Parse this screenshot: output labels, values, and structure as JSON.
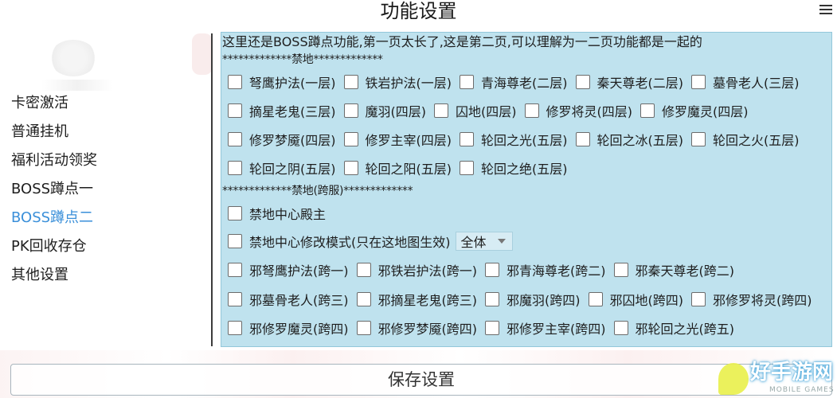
{
  "title": "功能设置",
  "sidebar": {
    "items": [
      {
        "label": "卡密激活",
        "active": false
      },
      {
        "label": "普通挂机",
        "active": false
      },
      {
        "label": "福利活动领奖",
        "active": false
      },
      {
        "label": "BOSS蹲点一",
        "active": false
      },
      {
        "label": "BOSS蹲点二",
        "active": true
      },
      {
        "label": "PK回收存仓",
        "active": false
      },
      {
        "label": "其他设置",
        "active": false
      }
    ]
  },
  "panel": {
    "intro": "这里还是BOSS蹲点功能,第一页太长了,这是第二页,可以理解为一二页功能都是一起的",
    "section1_header": "*************禁地*************",
    "section1_rows": [
      [
        "弩鹰护法(一层)",
        "铁岩护法(一层)",
        "青海尊老(二层)",
        "秦天尊老(二层)",
        "墓骨老人(三层)"
      ],
      [
        "摘星老鬼(三层)",
        "魔羽(四层)",
        "囚地(四层)",
        "修罗将灵(四层)",
        "修罗魔灵(四层)"
      ],
      [
        "修罗梦魇(四层)",
        "修罗主宰(四层)",
        "轮回之光(五层)",
        "轮回之冰(五层)",
        "轮回之火(五层)"
      ],
      [
        "轮回之阴(五层)",
        "轮回之阳(五层)",
        "轮回之绝(五层)"
      ]
    ],
    "section2_header": "*************禁地(跨服)*************",
    "center_lord_label": "禁地中心殿主",
    "center_mode_label": "禁地中心修改模式(只在这地图生效)",
    "center_mode_value": "全体",
    "section2_rows": [
      [
        "邪弩鹰护法(跨一)",
        "邪铁岩护法(跨一)",
        "邪青海尊老(跨二)",
        "邪秦天尊老(跨二)"
      ],
      [
        "邪墓骨老人(跨三)",
        "邪摘星老鬼(跨三)",
        "邪魔羽(跨四)",
        "邪囚地(跨四)",
        "邪修罗将灵(跨四)"
      ],
      [
        "邪修罗魔灵(跨四)",
        "邪修罗梦魇(跨四)",
        "邪修罗主宰(跨四)",
        "邪轮回之光(跨五)"
      ]
    ]
  },
  "save_label": "保存设置",
  "watermark": {
    "text": "好手游网",
    "sub": "MOBILE GAMES"
  },
  "colors": {
    "accent": "#3a8fd9",
    "panel_bg": "#bfe2ee"
  }
}
